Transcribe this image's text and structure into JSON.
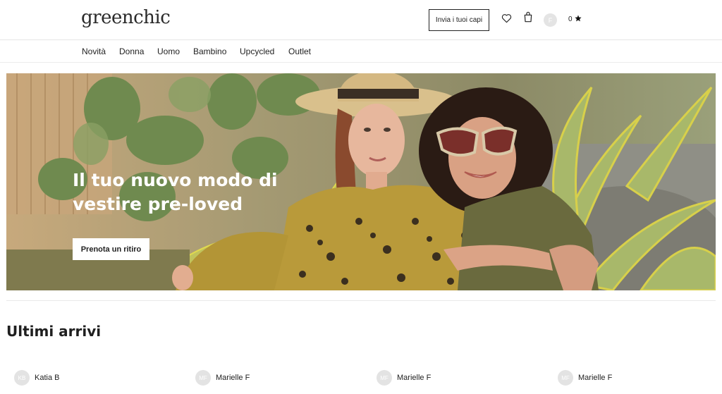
{
  "header": {
    "logo": "greenchic",
    "send_button": "Invia i tuoi capi",
    "avatar_initial": "F",
    "points": "0"
  },
  "nav": {
    "items": [
      "Novità",
      "Donna",
      "Uomo",
      "Bambino",
      "Upcycled",
      "Outlet"
    ]
  },
  "hero": {
    "title": "Il tuo nuovo modo di vestire pre-loved",
    "button": "Prenota un ritiro"
  },
  "section": {
    "title": "Ultimi arrivi"
  },
  "sellers": [
    {
      "initials": "KB",
      "name": "Katia B"
    },
    {
      "initials": "MF",
      "name": "Marielle F"
    },
    {
      "initials": "MF",
      "name": "Marielle F"
    },
    {
      "initials": "MF",
      "name": "Marielle F"
    }
  ],
  "icons": {
    "wishlist": "heart-icon",
    "cart": "shopping-bag-icon",
    "points": "star-icon"
  }
}
